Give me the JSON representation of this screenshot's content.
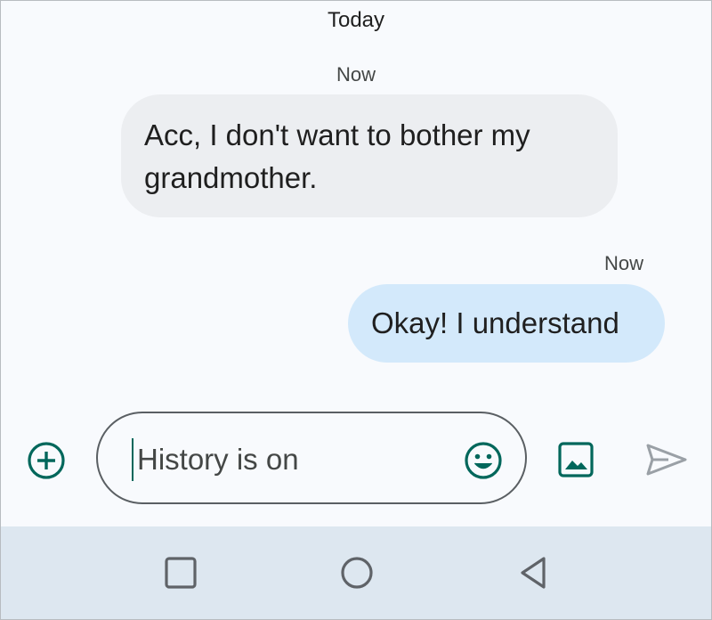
{
  "conversation": {
    "date_header": "Today",
    "messages": [
      {
        "direction": "incoming",
        "time": "Now",
        "lines": [
          "Acc, I don't want to bother my",
          "grandmother."
        ]
      },
      {
        "direction": "outgoing",
        "time": "Now",
        "text": "Okay! I understand"
      }
    ]
  },
  "composer": {
    "input_value": "",
    "input_placeholder": "History is on",
    "add_icon": "add-circle-icon",
    "emoji_icon": "emoji-icon",
    "gallery_icon": "gallery-icon",
    "send_icon": "send-icon"
  },
  "navigation": {
    "recents_icon": "square-icon",
    "home_icon": "circle-icon",
    "back_icon": "triangle-back-icon"
  },
  "colors": {
    "accent": "#00675b",
    "incoming_bubble": "#eceef1",
    "outgoing_bubble": "#d3e9fb",
    "nav_bar": "#dde7f0"
  }
}
